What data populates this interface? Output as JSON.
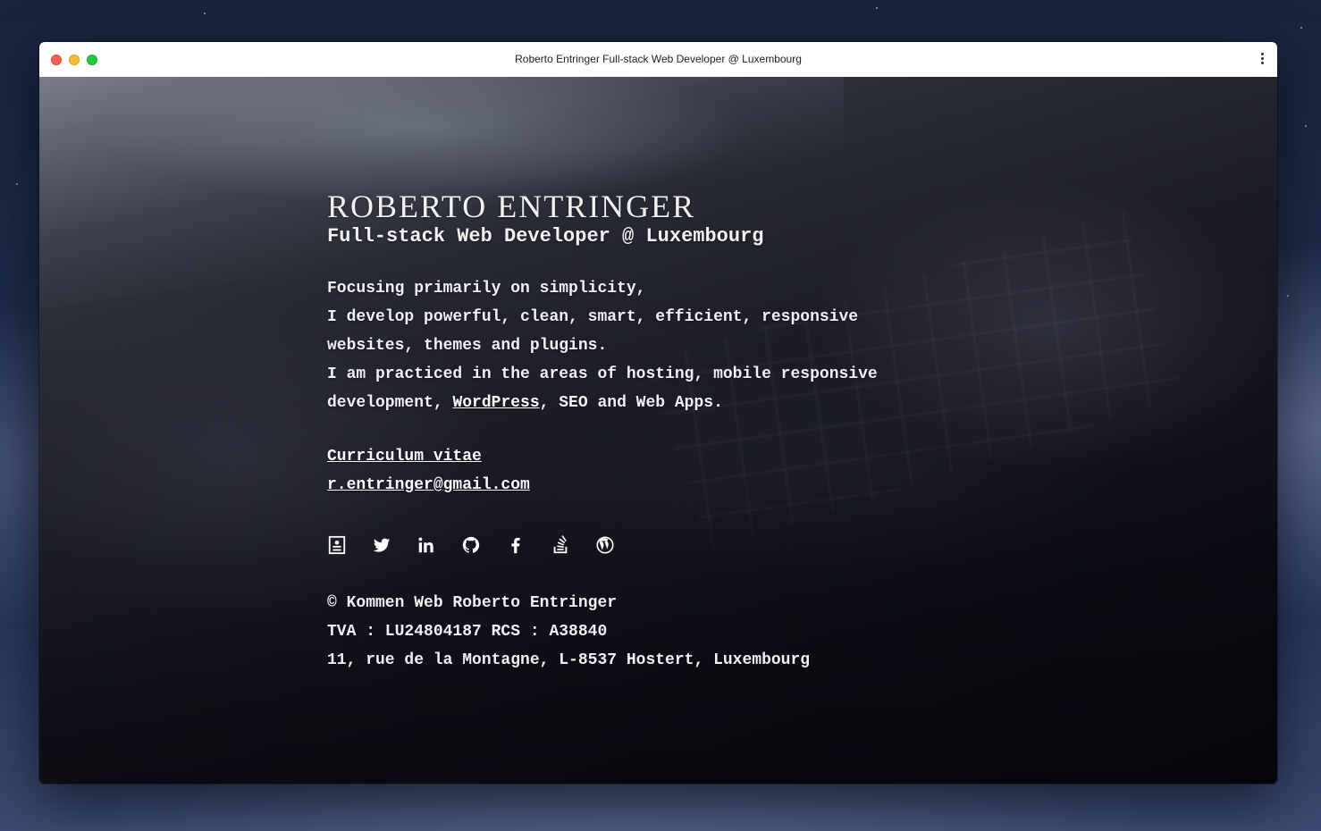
{
  "window": {
    "title": "Roberto Entringer Full-stack Web Developer @ Luxembourg"
  },
  "hero": {
    "name": "ROBERTO ENTRINGER",
    "subtitle": "Full-stack Web Developer @ Luxembourg"
  },
  "intro": {
    "line1": "Focusing primarily on simplicity,",
    "line2": "I develop powerful, clean, smart, efficient, responsive",
    "line3": "websites, themes and plugins.",
    "line4": "I am practiced in the areas of hosting, mobile responsive",
    "line5_before": "development, ",
    "line5_link": "WordPress",
    "line5_after": ", SEO and Web Apps."
  },
  "links": {
    "cv": "Curriculum vitae",
    "email": "r.entringer@gmail.com"
  },
  "social": [
    "contact-card-icon",
    "twitter-icon",
    "linkedin-icon",
    "github-icon",
    "facebook-icon",
    "stackoverflow-icon",
    "wordpress-icon"
  ],
  "footer": {
    "copyright": "© Kommen Web Roberto Entringer",
    "tax": "TVA : LU24804187 RCS : A38840",
    "address": "11, rue de la Montagne, L-8537 Hostert, Luxembourg"
  },
  "colors": {
    "text": "#ffffff",
    "close": "#ff5f57",
    "minimize": "#febc2e",
    "maximize": "#28c840"
  }
}
